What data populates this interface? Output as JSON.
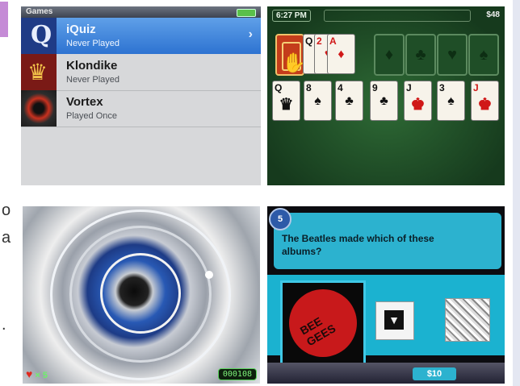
{
  "page": {
    "side_text_1": "o",
    "side_text_2": "a",
    "side_text_3": "."
  },
  "games_menu": {
    "title": "Games",
    "items": [
      {
        "name": "iQuiz",
        "status": "Never Played",
        "selected": true,
        "icon_letter": "Q"
      },
      {
        "name": "Klondike",
        "status": "Never Played",
        "selected": false
      },
      {
        "name": "Vortex",
        "status": "Played Once",
        "selected": false
      }
    ],
    "chevron": "›"
  },
  "solitaire": {
    "time": "6:27 PM",
    "money": "$48",
    "waste": [
      {
        "rank": "Q",
        "suit": "♣",
        "color": "blk"
      },
      {
        "rank": "2",
        "suit": "♥",
        "color": "red"
      },
      {
        "rank": "A",
        "suit": "♦",
        "color": "red"
      }
    ],
    "foundations": [
      "♦",
      "♣",
      "♥",
      "♠"
    ],
    "tableau": [
      {
        "rank": "Q",
        "suit": "♠",
        "color": "blk"
      },
      {
        "rank": "8",
        "suit": "♠",
        "color": "blk"
      },
      {
        "rank": "4",
        "suit": "♣",
        "color": "blk"
      },
      {
        "rank": "9",
        "suit": "♣",
        "color": "blk"
      },
      {
        "rank": "J",
        "suit": "♠",
        "color": "blk"
      },
      {
        "rank": "3",
        "suit": "♠",
        "color": "blk"
      },
      {
        "rank": "J",
        "suit": "♦",
        "color": "red"
      }
    ]
  },
  "vortex": {
    "lives_label": "× 5",
    "heart_icon": "♥",
    "score": "000108"
  },
  "quiz": {
    "level": "5",
    "question": "The Beatles made which of these albums?",
    "album1_text": "BEE GEES",
    "album2_icon": "▼",
    "prize": "$10"
  }
}
